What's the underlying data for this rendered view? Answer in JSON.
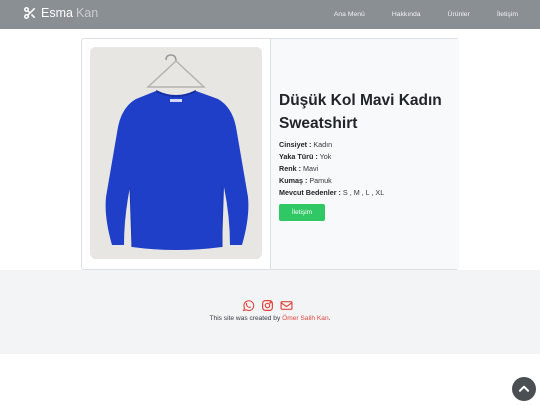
{
  "brand": {
    "name": "Esma",
    "suffix": "Kan"
  },
  "nav": {
    "items": [
      "Ana Menü",
      "Hakkında",
      "Ürünler",
      "İletişim"
    ]
  },
  "product": {
    "title": "Düşük Kol Mavi Kadın Sweatshirt",
    "attributes": [
      {
        "label": "Cinsiyet :",
        "value": "Kadın"
      },
      {
        "label": "Yaka Türü :",
        "value": "Yok"
      },
      {
        "label": "Renk :",
        "value": "Mavi"
      },
      {
        "label": "Kumaş :",
        "value": "Pamuk"
      },
      {
        "label": "Mevcut Bedenler :",
        "value": "S , M , L , XL"
      }
    ],
    "button_label": "İletişim",
    "image": "blue sweatshirt on hanger"
  },
  "footer": {
    "credit_prefix": "This site was created by",
    "credit_name": "Ömer Salih Kan",
    "credit_suffix": ".",
    "icons": [
      "whatsapp-icon",
      "instagram-icon",
      "mail-icon"
    ]
  },
  "colors": {
    "navbar": "#8a8f94",
    "accent": "#e0463d",
    "button": "#2fc864",
    "footer": "#f3f4f6"
  },
  "scroll_top_icon": "chevron-up-icon"
}
